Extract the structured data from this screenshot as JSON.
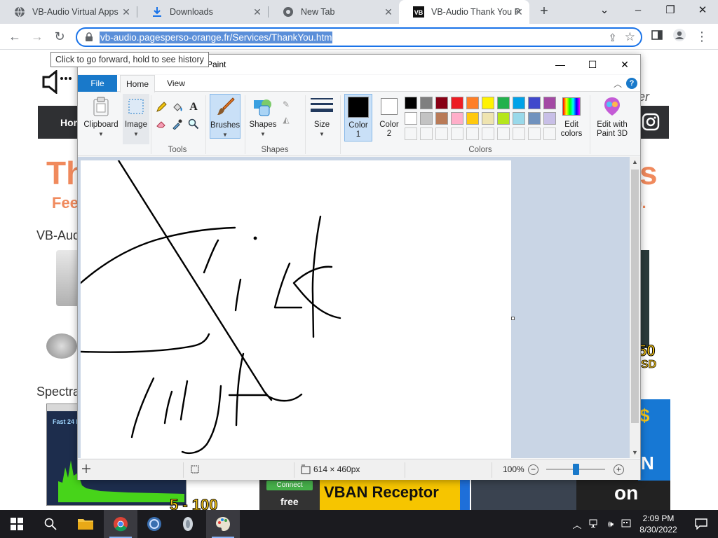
{
  "browser": {
    "tabs": [
      {
        "title": "VB-Audio Virtual Apps",
        "icon": "globe-icon"
      },
      {
        "title": "Downloads",
        "icon": "download-icon"
      },
      {
        "title": "New Tab",
        "icon": "chrome-icon"
      },
      {
        "title": "VB-Audio Thank You P",
        "icon": "vb-logo-icon"
      }
    ],
    "url": "vb-audio.pagesperso-orange.fr/Services/ThankYou.htm",
    "tooltip": "Click to go forward, hold to see history"
  },
  "webpage": {
    "nav_home": "Hom",
    "heading_fragment_left": "Th",
    "heading_fragment_right": "s",
    "sub_left": "Fee",
    "sub_right": "e).",
    "section1": "VB-Audi",
    "section2": "Spectra",
    "price_big": "50",
    "price_small": "SD",
    "banner_connect": "Connect",
    "banner_free": "free",
    "banner_vban": "VBAN Receptor",
    "banner_on": "on",
    "banner_n": "N",
    "banner_dollar": "$",
    "spectrum_label": "Fast 24 b",
    "spectrum_bottom": "5 - 100"
  },
  "paint": {
    "title": "Paint",
    "ribbon_tabs": [
      "File",
      "Home",
      "View"
    ],
    "groups": {
      "clipboard": "Clipboard",
      "image": "Image",
      "tools": "Tools",
      "brushes": "Brushes",
      "shapes_btn": "Shapes",
      "shapes_group": "Shapes",
      "size": "Size",
      "color1": "Color\n1",
      "color2": "Color\n2",
      "colors": "Colors",
      "edit_colors": "Edit\ncolors",
      "edit_paint3d": "Edit with\nPaint 3D"
    },
    "palette_row1": [
      "#000000",
      "#7f7f7f",
      "#880015",
      "#ed1c24",
      "#ff7f27",
      "#fff200",
      "#22b14c",
      "#00a2e8",
      "#3f48cc",
      "#a349a4"
    ],
    "palette_row2": [
      "#ffffff",
      "#c3c3c3",
      "#b97a57",
      "#ffaec9",
      "#ffc90e",
      "#efe4b0",
      "#b5e61d",
      "#99d9ea",
      "#7092be",
      "#c8bfe7"
    ],
    "status": {
      "image_size": "614 × 460px",
      "zoom": "100%"
    }
  },
  "taskbar": {
    "time": "2:09 PM",
    "date": "8/30/2022"
  }
}
